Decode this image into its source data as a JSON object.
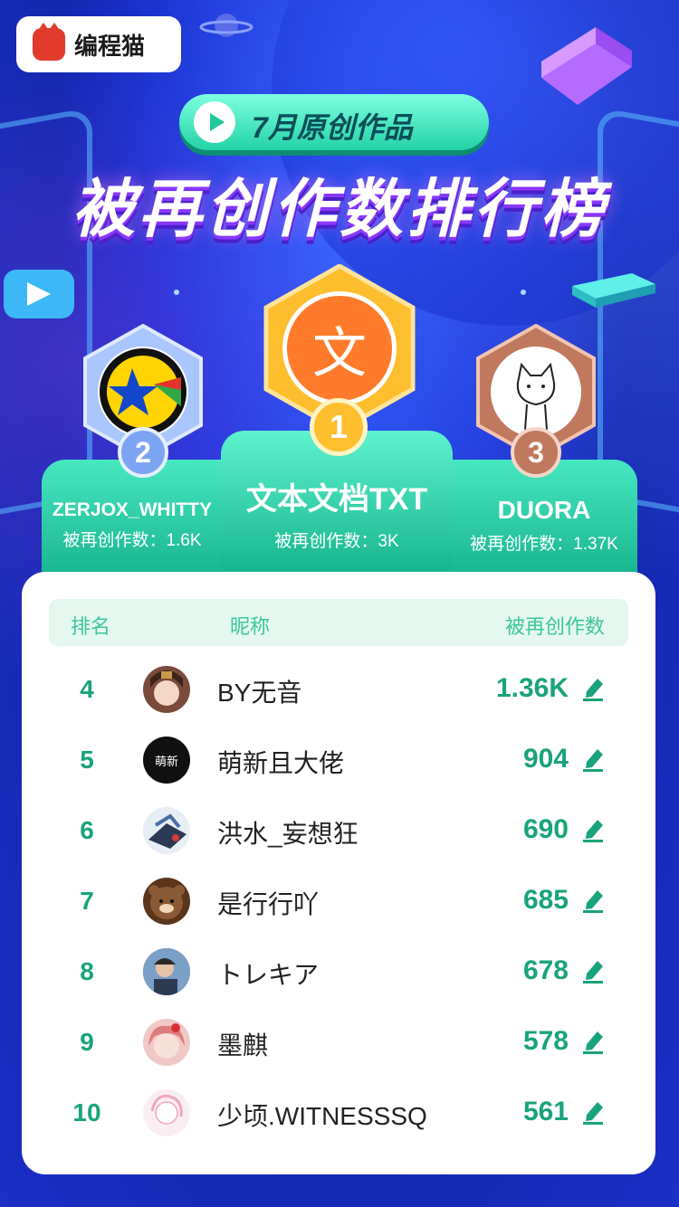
{
  "brand": {
    "name": "编程猫"
  },
  "header": {
    "subtitle": "7月原创作品",
    "title": "被再创作数排行榜"
  },
  "podium": {
    "first": {
      "rank": "1",
      "name": "文本文档TXT",
      "count_label": "被再创作数：3K",
      "avatar_glyph": "文"
    },
    "second": {
      "rank": "2",
      "name": "ZERJOX_WHITTY",
      "count_label": "被再创作数：1.6K"
    },
    "third": {
      "rank": "3",
      "name": "DUORA",
      "count_label": "被再创作数：1.37K"
    }
  },
  "table": {
    "headers": {
      "rank": "排名",
      "nickname": "昵称",
      "count": "被再创作数"
    },
    "rows": [
      {
        "rank": "4",
        "name": "BY无音",
        "count": "1.36K",
        "avatar_color": "#7a4a3a"
      },
      {
        "rank": "5",
        "name": "萌新且大佬",
        "count": "904",
        "avatar_color": "#111111",
        "avatar_text": "萌新"
      },
      {
        "rank": "6",
        "name": "洪水_妄想狂",
        "count": "690",
        "avatar_color": "#4a5d7a"
      },
      {
        "rank": "7",
        "name": "是行行吖",
        "count": "685",
        "avatar_color": "#7a4a2a"
      },
      {
        "rank": "8",
        "name": "トレキア",
        "count": "678",
        "avatar_color": "#3e5f86"
      },
      {
        "rank": "9",
        "name": "墨麒",
        "count": "578",
        "avatar_color": "#d9787a"
      },
      {
        "rank": "10",
        "name": "少顷.WITNESSSQ",
        "count": "561",
        "avatar_color": "#f2d4dd"
      }
    ]
  },
  "colors": {
    "accent_green": "#19a37c",
    "header_bg": "#e4f8ef",
    "gold": "#ffbe2e",
    "silver": "#7da4f2",
    "bronze": "#c0795e"
  },
  "icons": {
    "edit": "pen-icon",
    "play": "play-icon"
  }
}
